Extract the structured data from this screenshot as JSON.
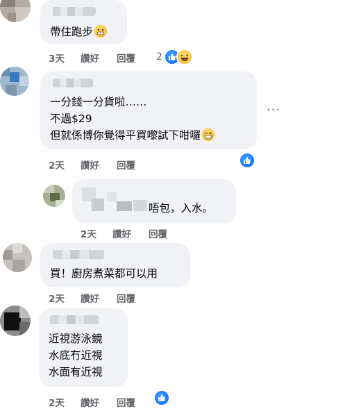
{
  "colors": {
    "bubble": "#f0f2f5",
    "action_text": "#65676b",
    "like_blue": "#0866ff",
    "haha_yellow": "#f7b125"
  },
  "comments": [
    {
      "lines": [
        "帶住跑步"
      ],
      "trailing_emoji": "grimace-emoji",
      "time": "3天",
      "like_label": "讚好",
      "reply_label": "回覆",
      "reaction_count": "2",
      "reactions": [
        "like-icon",
        "haha-icon"
      ]
    },
    {
      "lines": [
        "一分錢一分貨啦……",
        "不過$29",
        "但就係博你覺得平買嚟試下咁囉"
      ],
      "trailing_emoji": "grin-emoji",
      "time": "2天",
      "like_label": "讚好",
      "reply_label": "回覆",
      "reactions": [
        "like-icon"
      ],
      "more_label": "···"
    },
    {
      "lines": [
        "唔包，入水。"
      ],
      "time": "2天",
      "like_label": "讚好",
      "reply_label": "回覆"
    },
    {
      "lines": [
        "買！廚房煮菜都可以用"
      ],
      "time": "2天",
      "like_label": "讚好",
      "reply_label": "回覆"
    },
    {
      "lines": [
        "近視游泳鏡",
        "水底冇近視",
        "水面有近視"
      ],
      "time": "2天",
      "like_label": "讚好",
      "reply_label": "回覆",
      "reactions": [
        "like-icon"
      ]
    }
  ]
}
